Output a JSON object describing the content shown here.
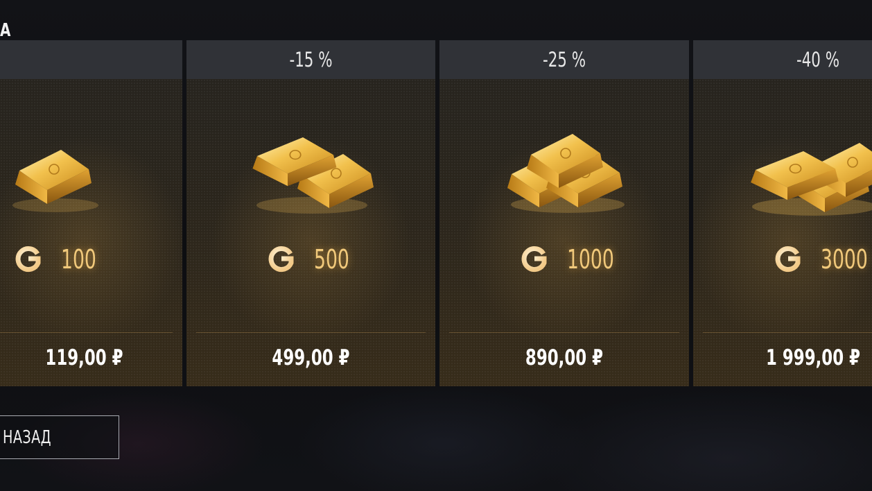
{
  "screen": {
    "title_fragment": "А"
  },
  "offers": [
    {
      "discount": "",
      "amount": "100",
      "price": "119,00 ₽",
      "bars": 1
    },
    {
      "discount": "-15 %",
      "amount": "500",
      "price": "499,00 ₽",
      "bars": 2
    },
    {
      "discount": "-25 %",
      "amount": "1000",
      "price": "890,00 ₽",
      "bars": 3
    },
    {
      "discount": "-40 %",
      "amount": "3000",
      "price": "1 999,00 ₽",
      "bars": 4
    }
  ],
  "icons": {
    "bars": "gold-bars-icon",
    "currency": "gold-currency-icon"
  },
  "footer": {
    "back_label": "НАЗАД"
  },
  "colors": {
    "gold_text": "#f1c97b",
    "card_header": "#303237",
    "background": "#0e0f12"
  }
}
